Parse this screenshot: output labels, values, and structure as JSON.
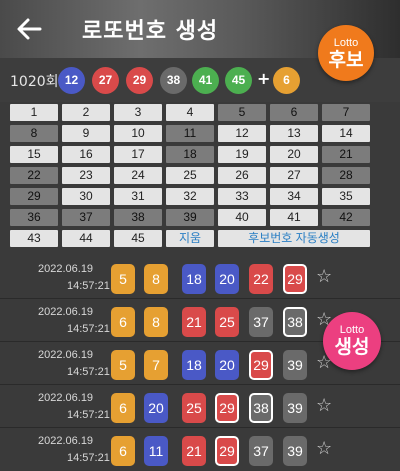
{
  "header": {
    "title": "로또번호 생성",
    "candidate_badge": {
      "small": "Lotto",
      "big": "후보"
    }
  },
  "generate_badge": {
    "small": "Lotto",
    "big": "생성"
  },
  "colors": {
    "blue": "#4a59c6",
    "red": "#d94a4a",
    "gray": "#6a6a6a",
    "green": "#4caf50",
    "orange": "#e6a032",
    "accent_text": "#2a7fc4"
  },
  "round": {
    "label": "1020회",
    "numbers": [
      "12",
      "27",
      "29",
      "38",
      "41",
      "45"
    ],
    "plus": "+",
    "bonus": "6"
  },
  "grid": {
    "numbers": [
      "1",
      "2",
      "3",
      "4",
      "5",
      "6",
      "7",
      "8",
      "9",
      "10",
      "11",
      "12",
      "13",
      "14",
      "15",
      "16",
      "17",
      "18",
      "19",
      "20",
      "21",
      "22",
      "23",
      "24",
      "25",
      "26",
      "27",
      "28",
      "29",
      "30",
      "31",
      "32",
      "33",
      "34",
      "35",
      "36",
      "37",
      "38",
      "39",
      "40",
      "41",
      "42",
      "43",
      "44",
      "45"
    ],
    "reset_label": "지움",
    "auto_label": "후보번호 자동생성"
  },
  "generated": [
    {
      "date": "2022.06.19",
      "time": "14:57:21",
      "numbers": [
        "5",
        "8",
        "18",
        "20",
        "22",
        "29"
      ]
    },
    {
      "date": "2022.06.19",
      "time": "14:57:21",
      "numbers": [
        "6",
        "8",
        "21",
        "25",
        "37",
        "38"
      ]
    },
    {
      "date": "2022.06.19",
      "time": "14:57:21",
      "numbers": [
        "5",
        "7",
        "18",
        "20",
        "29",
        "39"
      ]
    },
    {
      "date": "2022.06.19",
      "time": "14:57:21",
      "numbers": [
        "6",
        "20",
        "25",
        "29",
        "38",
        "39"
      ]
    },
    {
      "date": "2022.06.19",
      "time": "14:57:21",
      "numbers": [
        "6",
        "11",
        "21",
        "29",
        "37",
        "39"
      ]
    }
  ],
  "star_icon": "☆"
}
